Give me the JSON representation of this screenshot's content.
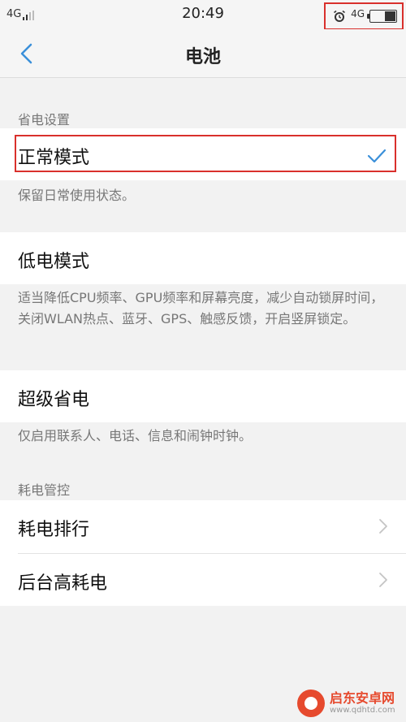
{
  "status_bar": {
    "left_network": "4G",
    "time": "20:49",
    "right_network": "4G",
    "battery_level": 0.45
  },
  "nav": {
    "title": "电池"
  },
  "power_settings": {
    "header": "省电设置",
    "modes": [
      {
        "label": "正常模式",
        "description": "保留日常使用状态。",
        "selected": true
      },
      {
        "label": "低电模式",
        "description": "适当降低CPU频率、GPU频率和屏幕亮度，减少自动锁屏时间，关闭WLAN热点、蓝牙、GPS、触感反馈，开启竖屏锁定。",
        "selected": false
      },
      {
        "label": "超级省电",
        "description": "仅启用联系人、电话、信息和闹钟时钟。",
        "selected": false
      }
    ]
  },
  "power_control": {
    "header": "耗电管控",
    "items": [
      {
        "label": "耗电排行"
      },
      {
        "label": "后台高耗电"
      }
    ]
  },
  "watermark": {
    "name": "启东安卓网",
    "url": "www.qdhtd.com"
  },
  "colors": {
    "accent": "#3a8fd9",
    "highlight": "#d9302c"
  }
}
